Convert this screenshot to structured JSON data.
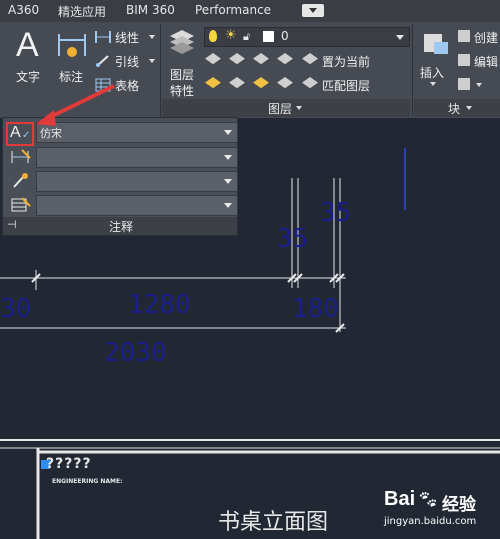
{
  "tabs": [
    "A360",
    "精选应用",
    "BIM 360",
    "Performance"
  ],
  "ribbon": {
    "text_label": "文字",
    "dim_label": "标注",
    "linear_label": "线性",
    "leader_label": "引线",
    "table_label": "表格",
    "layer_props_label_1": "图层",
    "layer_props_label_2": "特性",
    "layer_dropdown_value": "0",
    "set_current_label": "置为当前",
    "match_layer_label": "匹配图层",
    "layer_panel_label": "图层",
    "insert_label": "插入",
    "create_label": "创建",
    "edit_label": "编辑",
    "block_panel_label": "块"
  },
  "annotation_panel": {
    "text_style_value": "仿宋",
    "panel_label": "注释"
  },
  "drawing": {
    "dim_35_upper": "35",
    "dim_35_lower": "35",
    "dim_1280": "1280",
    "dim_180": "180",
    "dim_30": "30",
    "dim_2030": "2030",
    "title_question": "?????",
    "engineering_name": "ENGINEERING NAME:",
    "drawing_title": "书桌立面图"
  },
  "watermark": {
    "brand_text": "Bai",
    "brand_text_2": "经验",
    "url": "jingyan.baidu.com"
  },
  "colors": {
    "accent_red": "#e03a3a",
    "dim_blue": "#1a1f8c",
    "canvas": "#212834"
  }
}
